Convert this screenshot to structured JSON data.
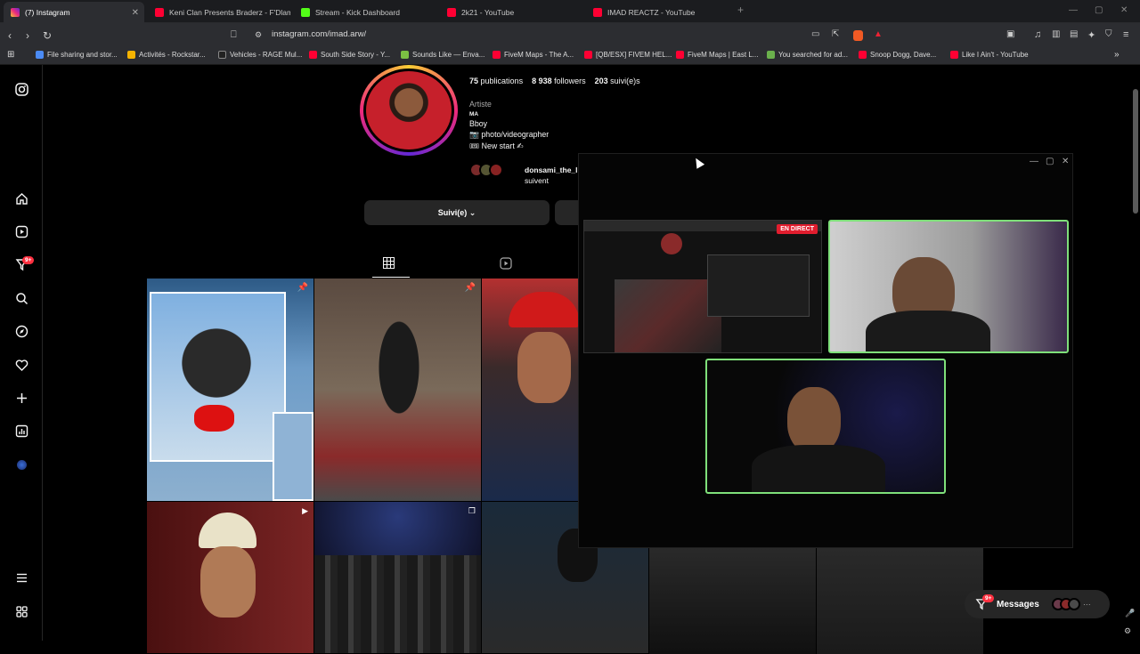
{
  "browser": {
    "tabs": [
      {
        "label": "(7) Instagram",
        "icon": "instagram-icon",
        "color": "#e1306c"
      },
      {
        "label": "Keni Clan Presents Braderz - F'Dlam",
        "icon": "youtube-icon",
        "color": "#ff0033"
      },
      {
        "label": "Stream - Kick Dashboard",
        "icon": "kick-icon",
        "color": "#53fc18"
      },
      {
        "label": "2k21 - YouTube",
        "icon": "youtube-icon",
        "color": "#ff0033"
      },
      {
        "label": "IMAD REACTZ - YouTube",
        "icon": "youtube-icon",
        "color": "#ff0033"
      }
    ],
    "new_tab": "+",
    "url": "instagram.com/imad.arw/",
    "bookmarks": [
      "File sharing and stor...",
      "Activités - Rockstar...",
      "Vehicles - RAGE Mul...",
      "South Side Story - Y...",
      "Sounds Like — Enva...",
      "FiveM Maps - The A...",
      "[QB/ESX] FIVEM HEL...",
      "FiveM Maps | East L...",
      "You searched for ad...",
      "Snoop Dogg, Dave...",
      "Like I Ain't - YouTube"
    ]
  },
  "sidebar": {
    "items": [
      "instagram-logo-icon",
      "home-icon",
      "reels-icon",
      "notifications-icon",
      "search-icon",
      "explore-icon",
      "heart-icon",
      "create-icon",
      "dashboard-icon",
      "profile-icon"
    ],
    "notif_badge": "9+",
    "menu_icon": "hamburger-icon",
    "threads_icon": "threads-icon"
  },
  "profile": {
    "publications_count": "75",
    "publications_label": "publications",
    "followers_count": "8 938",
    "followers_label": "followers",
    "following_count": "203",
    "following_label": "suivi(e)s",
    "category": "Artiste",
    "bio_line1": "MA",
    "bio_line2": "Bboy",
    "bio_line3": "📷 photo/videographer",
    "bio_line4": "🎟 New start ✍",
    "followed_by_name": "donsami_the_l",
    "followed_by_suffix": "suivent",
    "follow_button": "Suivi(e) ⌄"
  },
  "popup": {
    "live_label": "EN DIRECT"
  },
  "messages": {
    "label": "Messages",
    "badge": "9+"
  },
  "colors": {
    "accent_green": "#7fe07a",
    "live_red": "#e11d2e",
    "badge_red": "#ff3040"
  }
}
